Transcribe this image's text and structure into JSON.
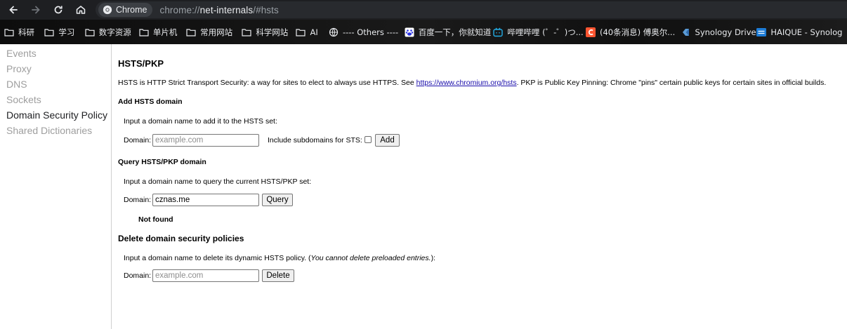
{
  "browser": {
    "chip_label": "Chrome",
    "url": {
      "scheme": "chrome://",
      "host": "net-internals",
      "path": "/#hsts"
    }
  },
  "bookmarks": [
    {
      "icon": "folder-icon",
      "label": "科研"
    },
    {
      "icon": "folder-icon",
      "label": "学习"
    },
    {
      "icon": "folder-icon",
      "label": "数字资源"
    },
    {
      "icon": "folder-icon",
      "label": "单片机"
    },
    {
      "icon": "folder-icon",
      "label": "常用网站"
    },
    {
      "icon": "folder-icon",
      "label": "科学网站"
    },
    {
      "icon": "folder-icon",
      "label": "AI"
    },
    {
      "icon": "globe-icon",
      "label": "---- Others ----"
    },
    {
      "icon": "baidu-paw-icon",
      "label": "百度一下，你就知道"
    },
    {
      "icon": "bilibili-icon",
      "label": "哔哩哔哩 (゜-゜)つ..."
    },
    {
      "icon": "csdn-icon",
      "label": "(40条消息) 傅奥尔..."
    },
    {
      "icon": "synology-icon",
      "label": "Synology Drive"
    },
    {
      "icon": "dsm-icon",
      "label": "HAIQUE - Synolog"
    }
  ],
  "sidebar": {
    "items": [
      "Events",
      "Proxy",
      "DNS",
      "Sockets",
      "Domain Security Policy",
      "Shared Dictionaries"
    ],
    "active_index": 4
  },
  "main": {
    "title": "HSTS/PKP",
    "desc_before": "HSTS is HTTP Strict Transport Security: a way for sites to elect to always use HTTPS. See ",
    "desc_link": "https://www.chromium.org/hsts",
    "desc_after": ". PKP is Public Key Pinning: Chrome \"pins\" certain public keys for certain sites in official builds.",
    "add": {
      "heading": "Add HSTS domain",
      "prompt": "Input a domain name to add it to the HSTS set:",
      "domain_label": "Domain:",
      "placeholder": "example.com",
      "value": "",
      "subdomains_label": "Include subdomains for STS:",
      "subdomains_checked": false,
      "button": "Add"
    },
    "query": {
      "heading": "Query HSTS/PKP domain",
      "prompt": "Input a domain name to query the current HSTS/PKP set:",
      "domain_label": "Domain:",
      "value": "cznas.me",
      "button": "Query",
      "result": "Not found"
    },
    "delete": {
      "heading": "Delete domain security policies",
      "prompt_before": "Input a domain name to delete its dynamic HSTS policy. (",
      "prompt_italic": "You cannot delete preloaded entries.",
      "prompt_after": "):",
      "domain_label": "Domain:",
      "placeholder": "example.com",
      "value": "",
      "button": "Delete"
    }
  },
  "colors": {
    "link": "#1a0dab",
    "toolbar": "#1e1f22",
    "sidebar_inactive": "#9e9e9e"
  }
}
